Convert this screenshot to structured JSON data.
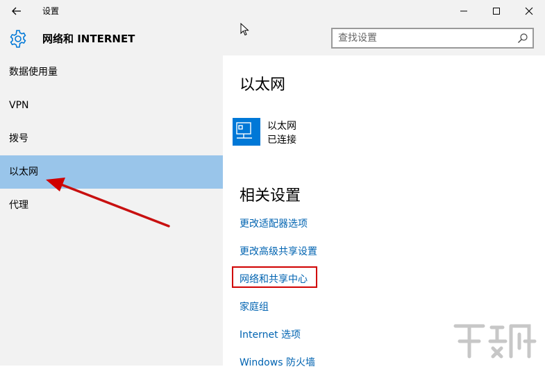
{
  "window": {
    "title": "设置",
    "back_icon": "back-arrow-icon",
    "minimize_icon": "minimize-icon",
    "maximize_icon": "maximize-icon",
    "close_icon": "close-icon"
  },
  "header": {
    "icon": "gear-icon",
    "title": "网络和 INTERNET"
  },
  "search": {
    "placeholder": "查找设置",
    "value": "",
    "icon": "search-icon"
  },
  "sidebar": {
    "items": [
      {
        "label": "数据使用量",
        "selected": false
      },
      {
        "label": "VPN",
        "selected": false
      },
      {
        "label": "拨号",
        "selected": false
      },
      {
        "label": "以太网",
        "selected": true
      },
      {
        "label": "代理",
        "selected": false
      }
    ]
  },
  "main": {
    "title": "以太网",
    "ethernet": {
      "icon": "ethernet-icon",
      "name": "以太网",
      "status": "已连接"
    },
    "related_title": "相关设置",
    "links": [
      {
        "label": "更改适配器选项",
        "highlighted": false
      },
      {
        "label": "更改高级共享设置",
        "highlighted": false
      },
      {
        "label": "网络和共享中心",
        "highlighted": true
      },
      {
        "label": "家庭组",
        "highlighted": false
      },
      {
        "label": "Internet 选项",
        "highlighted": false
      },
      {
        "label": "Windows 防火墙",
        "highlighted": false
      }
    ]
  },
  "colors": {
    "sidebar_bg": "#f2f2f2",
    "selected_bg": "#99c5ea",
    "accent": "#0078d7",
    "link": "#0063b1",
    "annotation": "#d00000"
  }
}
